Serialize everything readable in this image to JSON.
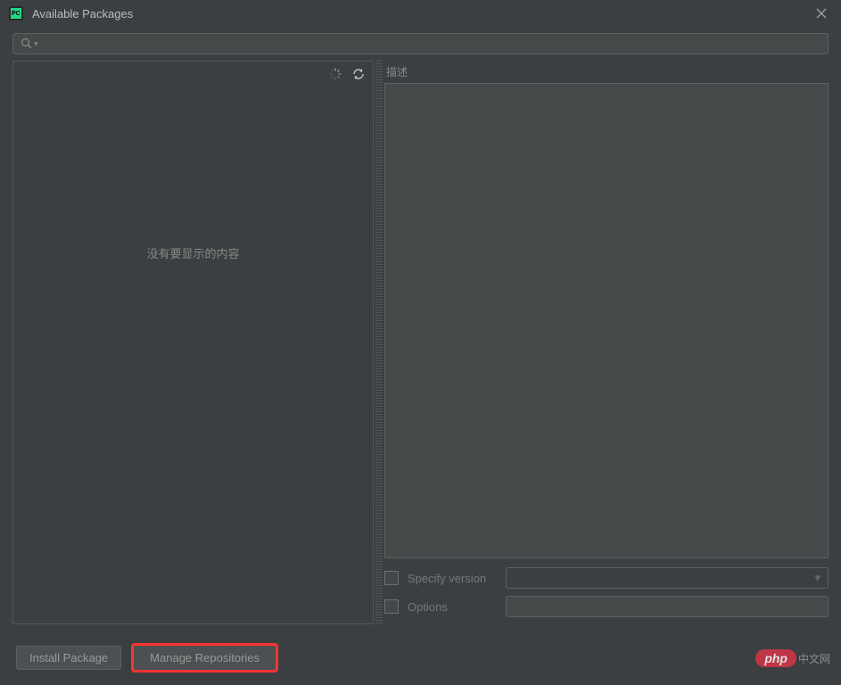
{
  "title": "Available Packages",
  "search": {
    "placeholder": ""
  },
  "leftPanel": {
    "emptyMessage": "没有要显示的内容"
  },
  "rightPanel": {
    "descriptionLabel": "描述",
    "specifyVersionLabel": "Specify version",
    "optionsLabel": "Options"
  },
  "buttons": {
    "installPackage": "Install Package",
    "manageRepositories": "Manage Repositories"
  },
  "watermark": {
    "badge": "php",
    "text": "中文网"
  }
}
